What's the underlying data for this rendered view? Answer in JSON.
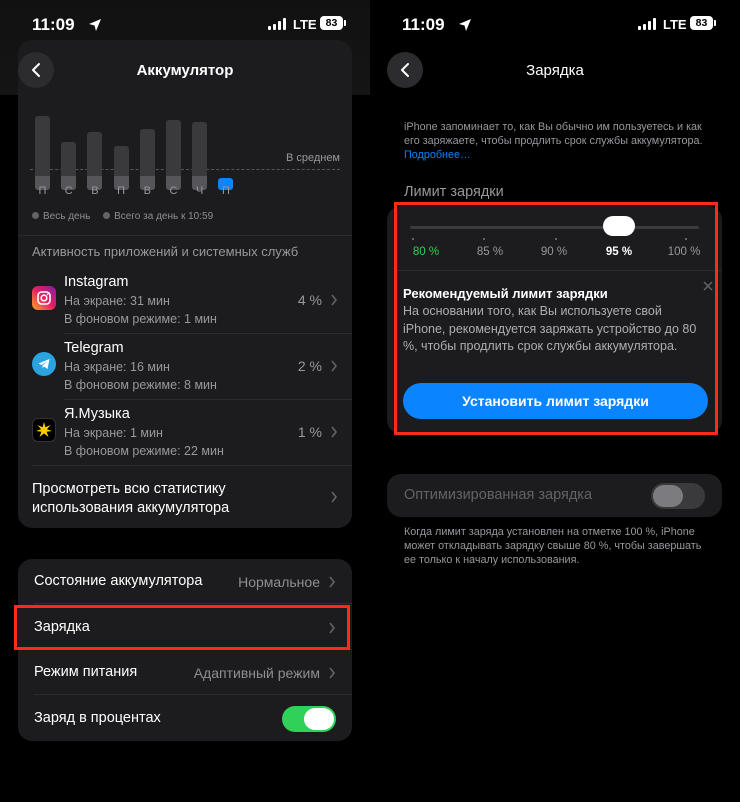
{
  "status_bar": {
    "time": "11:09",
    "network": "LTE",
    "battery": "83"
  },
  "left": {
    "title": "Аккумулятор",
    "chart_data": {
      "type": "bar",
      "categories": [
        "П",
        "С",
        "В",
        "П",
        "В",
        "С",
        "Ч",
        "П"
      ],
      "values": [
        0.92,
        0.6,
        0.72,
        0.55,
        0.76,
        0.88,
        0.85,
        0.1
      ],
      "average_label": "В среднем"
    },
    "legend": {
      "all_day": "Весь день",
      "total": "Всего за день к 10:59"
    },
    "section_header": "Активность приложений и системных служб",
    "apps": [
      {
        "name": "Instagram",
        "screen": "На экране: 31 мин",
        "background": "В фоновом режиме: 1 мин",
        "percent": "4 %"
      },
      {
        "name": "Telegram",
        "screen": "На экране: 16 мин",
        "background": "В фоновом режиме: 8 мин",
        "percent": "2 %"
      },
      {
        "name": "Я.Музыка",
        "screen": "На экране: 1 мин",
        "background": "В фоновом режиме: 22 мин",
        "percent": "1 %"
      }
    ],
    "all_stats_line1": "Просмотреть всю статистику",
    "all_stats_line2": "использования аккумулятора",
    "settings": [
      {
        "label": "Состояние аккумулятора",
        "value": "Нормальное"
      },
      {
        "label": "Зарядка",
        "value": ""
      },
      {
        "label": "Режим питания",
        "value": "Адаптивный режим"
      },
      {
        "label": "Заряд в процентах",
        "value": ""
      }
    ],
    "percent_toggle_on": true
  },
  "right": {
    "title": "Зарядка",
    "intro": "iPhone запоминает то, как Вы обычно им пользуетесь и как его заряжаете, чтобы продлить срок службы аккумулятора.",
    "intro_link": "Подробнее…",
    "limit_header": "Лимит зарядки",
    "ticks": [
      "80 %",
      "85 %",
      "90 %",
      "95 %",
      "100 %"
    ],
    "selected_limit": "95 %",
    "recommended_limit": "80 %",
    "tip_title": "Рекомендуемый лимит зарядки",
    "tip_body": "На основании того, как Вы используете свой iPhone, рекомендуется заряжать устройство до 80 %, чтобы продлить срок службы аккумулятора.",
    "cta": "Установить лимит зарядки",
    "optimized_label": "Оптимизированная зарядка",
    "optimized_on": false,
    "note": "Когда лимит заряда установлен на отметке 100 %, iPhone может откладывать зарядку свыше 80 %, чтобы завершать ее только к началу использования."
  },
  "colors": {
    "accent": "#0a84ff",
    "highlight": "#ff2a1a",
    "toggle_on": "#30d158"
  },
  "icons": [
    "back-chevron-icon",
    "location-arrow-icon",
    "signal-icon",
    "battery-icon",
    "chevron-right-icon",
    "close-icon",
    "instagram-icon",
    "telegram-icon",
    "yandex-music-icon"
  ]
}
